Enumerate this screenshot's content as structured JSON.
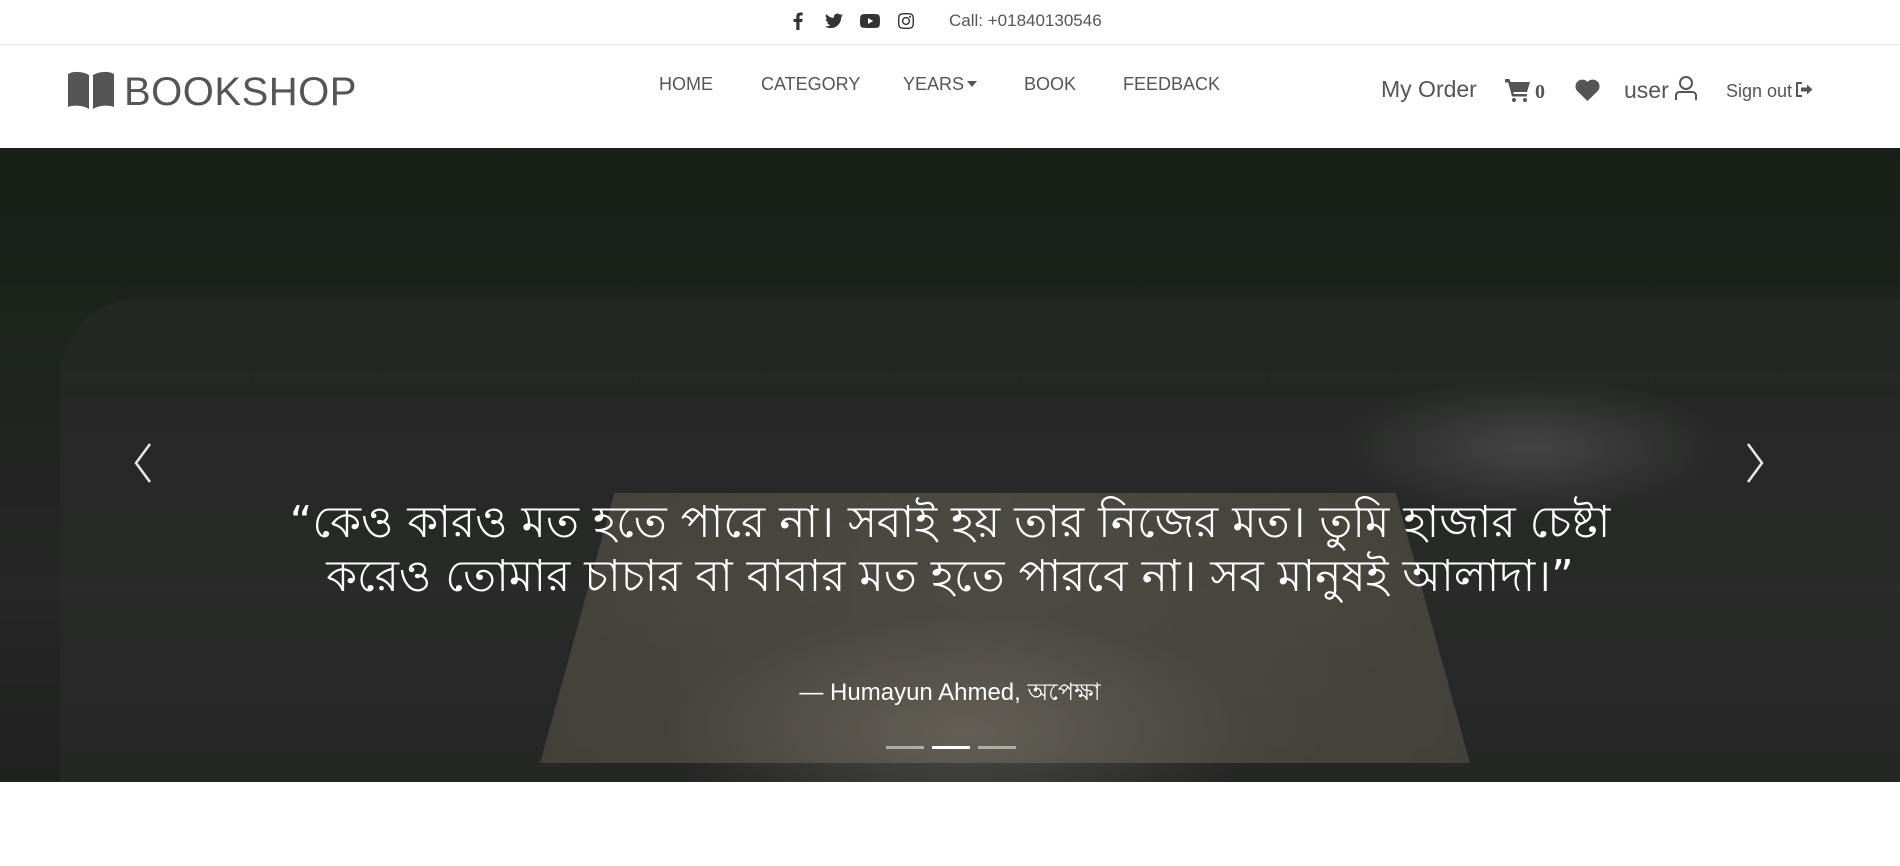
{
  "topbar": {
    "social_icons": [
      "facebook-icon",
      "twitter-icon",
      "youtube-icon",
      "instagram-icon"
    ],
    "call_text": "Call: +01840130546"
  },
  "brand": {
    "icon": "open-book-icon",
    "name": "BOOKSHOP"
  },
  "nav": {
    "items": [
      {
        "label": "HOME"
      },
      {
        "label": "CATEGORY"
      },
      {
        "label": "YEARS",
        "dropdown": true
      },
      {
        "label": "BOOK"
      },
      {
        "label": "FEEDBACK"
      }
    ]
  },
  "account": {
    "my_order": "My Order",
    "cart_count": "0",
    "cart_icon": "cart-icon",
    "wishlist_icon": "heart-icon",
    "user_label": "user",
    "user_icon": "user-icon",
    "signout_label": "Sign out",
    "signout_icon": "sign-out-icon"
  },
  "hero": {
    "quote": "“কেও কারও মত হতে পারে না। সবাই হয় তার নিজের মত। তুমি হাজার চেষ্টা করেও তোমার চাচার বা বাবার মত হতে পারবে না। সব মানুষই আলাদা।”",
    "author": "— Humayun Ahmed, অপেক্ষা",
    "prev_icon": "chevron-left-icon",
    "next_icon": "chevron-right-icon",
    "slide_count": 3,
    "active_slide": 2
  },
  "colors": {
    "text": "#555555",
    "hero_text": "#ffffff"
  }
}
